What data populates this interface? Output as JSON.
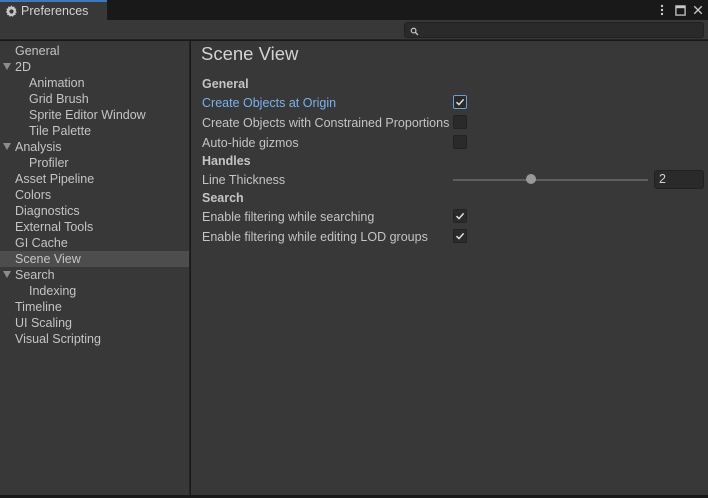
{
  "window": {
    "tab_title": "Preferences",
    "tab_icon": "gear-icon",
    "controls": [
      "more-options-icon",
      "maximize-icon",
      "close-icon"
    ]
  },
  "search": {
    "placeholder": ""
  },
  "sidebar": {
    "items": [
      {
        "label": "General",
        "level": 0,
        "expandable": false,
        "selected": false
      },
      {
        "label": "2D",
        "level": 0,
        "expandable": true,
        "selected": false
      },
      {
        "label": "Animation",
        "level": 1,
        "expandable": false,
        "selected": false
      },
      {
        "label": "Grid Brush",
        "level": 1,
        "expandable": false,
        "selected": false
      },
      {
        "label": "Sprite Editor Window",
        "level": 1,
        "expandable": false,
        "selected": false
      },
      {
        "label": "Tile Palette",
        "level": 1,
        "expandable": false,
        "selected": false
      },
      {
        "label": "Analysis",
        "level": 0,
        "expandable": true,
        "selected": false
      },
      {
        "label": "Profiler",
        "level": 1,
        "expandable": false,
        "selected": false
      },
      {
        "label": "Asset Pipeline",
        "level": 0,
        "expandable": false,
        "selected": false
      },
      {
        "label": "Colors",
        "level": 0,
        "expandable": false,
        "selected": false
      },
      {
        "label": "Diagnostics",
        "level": 0,
        "expandable": false,
        "selected": false
      },
      {
        "label": "External Tools",
        "level": 0,
        "expandable": false,
        "selected": false
      },
      {
        "label": "GI Cache",
        "level": 0,
        "expandable": false,
        "selected": false
      },
      {
        "label": "Scene View",
        "level": 0,
        "expandable": false,
        "selected": true
      },
      {
        "label": "Search",
        "level": 0,
        "expandable": true,
        "selected": false
      },
      {
        "label": "Indexing",
        "level": 1,
        "expandable": false,
        "selected": false
      },
      {
        "label": "Timeline",
        "level": 0,
        "expandable": false,
        "selected": false
      },
      {
        "label": "UI Scaling",
        "level": 0,
        "expandable": false,
        "selected": false
      },
      {
        "label": "Visual Scripting",
        "level": 0,
        "expandable": false,
        "selected": false
      }
    ]
  },
  "main": {
    "title": "Scene View",
    "sections": {
      "general": "General",
      "handles": "Handles",
      "search": "Search"
    },
    "settings": {
      "create_at_origin": {
        "label": "Create Objects at Origin",
        "checked": true
      },
      "constrained_proportions": {
        "label": "Create Objects with Constrained Proportions",
        "checked": false
      },
      "auto_hide_gizmos": {
        "label": "Auto-hide gizmos",
        "checked": false
      },
      "line_thickness": {
        "label": "Line Thickness",
        "value": "2",
        "slider_fraction": 0.4
      },
      "filter_while_searching": {
        "label": "Enable filtering while searching",
        "checked": true
      },
      "filter_lod_groups": {
        "label": "Enable filtering while editing LOD groups",
        "checked": true
      }
    }
  },
  "colors": {
    "accent": "#3a79bb",
    "highlight_text": "#7bb0f0",
    "panel": "#383838",
    "selected_row": "#4d4d4d"
  }
}
